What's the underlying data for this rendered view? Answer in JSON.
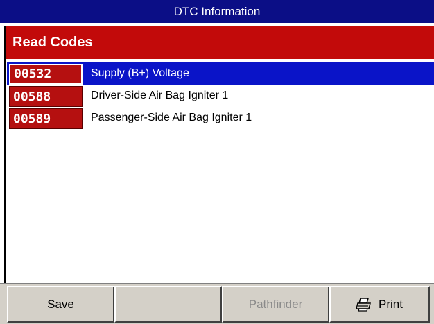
{
  "window": {
    "title": "DTC Information"
  },
  "section": {
    "title": "Read Codes"
  },
  "codes": [
    {
      "code": "00532",
      "description": "Supply (B+) Voltage",
      "selected": true
    },
    {
      "code": "00588",
      "description": "Driver-Side Air Bag Igniter 1",
      "selected": false
    },
    {
      "code": "00589",
      "description": "Passenger-Side Air Bag Igniter 1",
      "selected": false
    }
  ],
  "toolbar": {
    "save_label": "Save",
    "blank_label": "",
    "pathfinder_label": "Pathfinder",
    "print_label": "Print"
  },
  "colors": {
    "title_bar": "#0b0e86",
    "section_header": "#c20a0a",
    "selection": "#0a14c8",
    "code_badge": "#b51010",
    "toolbar": "#d4d0c8"
  },
  "icons": {
    "print": "printer-icon"
  }
}
